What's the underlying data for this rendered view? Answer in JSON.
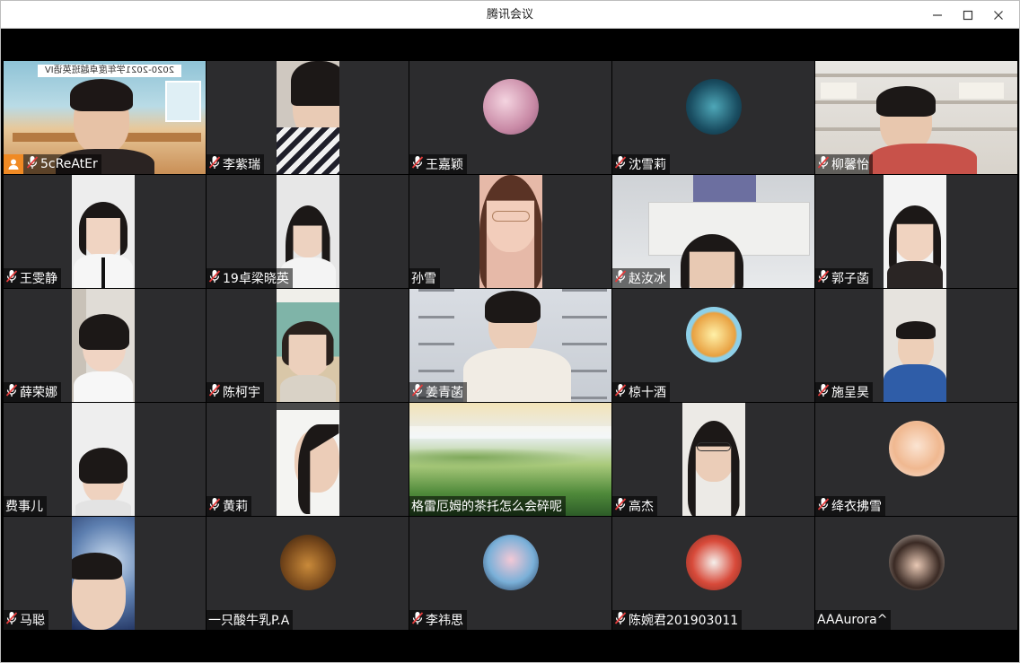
{
  "window": {
    "title": "腾讯会议"
  },
  "colors": {
    "tile_bg": "#2c2c2e",
    "host_badge": "#f08a24",
    "mic_red": "#e23b3b"
  },
  "banner": {
    "text": "2020-2021学年度卓越班英语IV"
  },
  "participants": [
    {
      "name": "5cReAtEr",
      "mic": true,
      "host": true
    },
    {
      "name": "李紫瑞",
      "mic": true
    },
    {
      "name": "王嘉颖",
      "mic": true
    },
    {
      "name": "沈雪莉",
      "mic": true
    },
    {
      "name": "柳馨怡",
      "mic": true
    },
    {
      "name": "王雯静",
      "mic": true
    },
    {
      "name": "19卓梁晓英",
      "mic": true
    },
    {
      "name": "孙雪",
      "mic": false
    },
    {
      "name": "赵汝冰",
      "mic": true
    },
    {
      "name": "郭子菡",
      "mic": true
    },
    {
      "name": "薛荣娜",
      "mic": true
    },
    {
      "name": "陈柯宇",
      "mic": true
    },
    {
      "name": "姜青菡",
      "mic": true
    },
    {
      "name": "椋十酒",
      "mic": true
    },
    {
      "name": "施呈昊",
      "mic": true
    },
    {
      "name": "费事儿",
      "mic": false
    },
    {
      "name": "黄莉",
      "mic": true
    },
    {
      "name": "格雷厄姆的茶托怎么会碎呢",
      "mic": false
    },
    {
      "name": "高杰",
      "mic": true
    },
    {
      "name": "绛衣拂雪",
      "mic": true
    },
    {
      "name": "马聪",
      "mic": true
    },
    {
      "name": "一只酸牛乳P.A",
      "mic": false
    },
    {
      "name": "李祎思",
      "mic": true
    },
    {
      "name": "陈婉君201903011",
      "mic": true
    },
    {
      "name": "AAAurora^",
      "mic": false
    }
  ]
}
